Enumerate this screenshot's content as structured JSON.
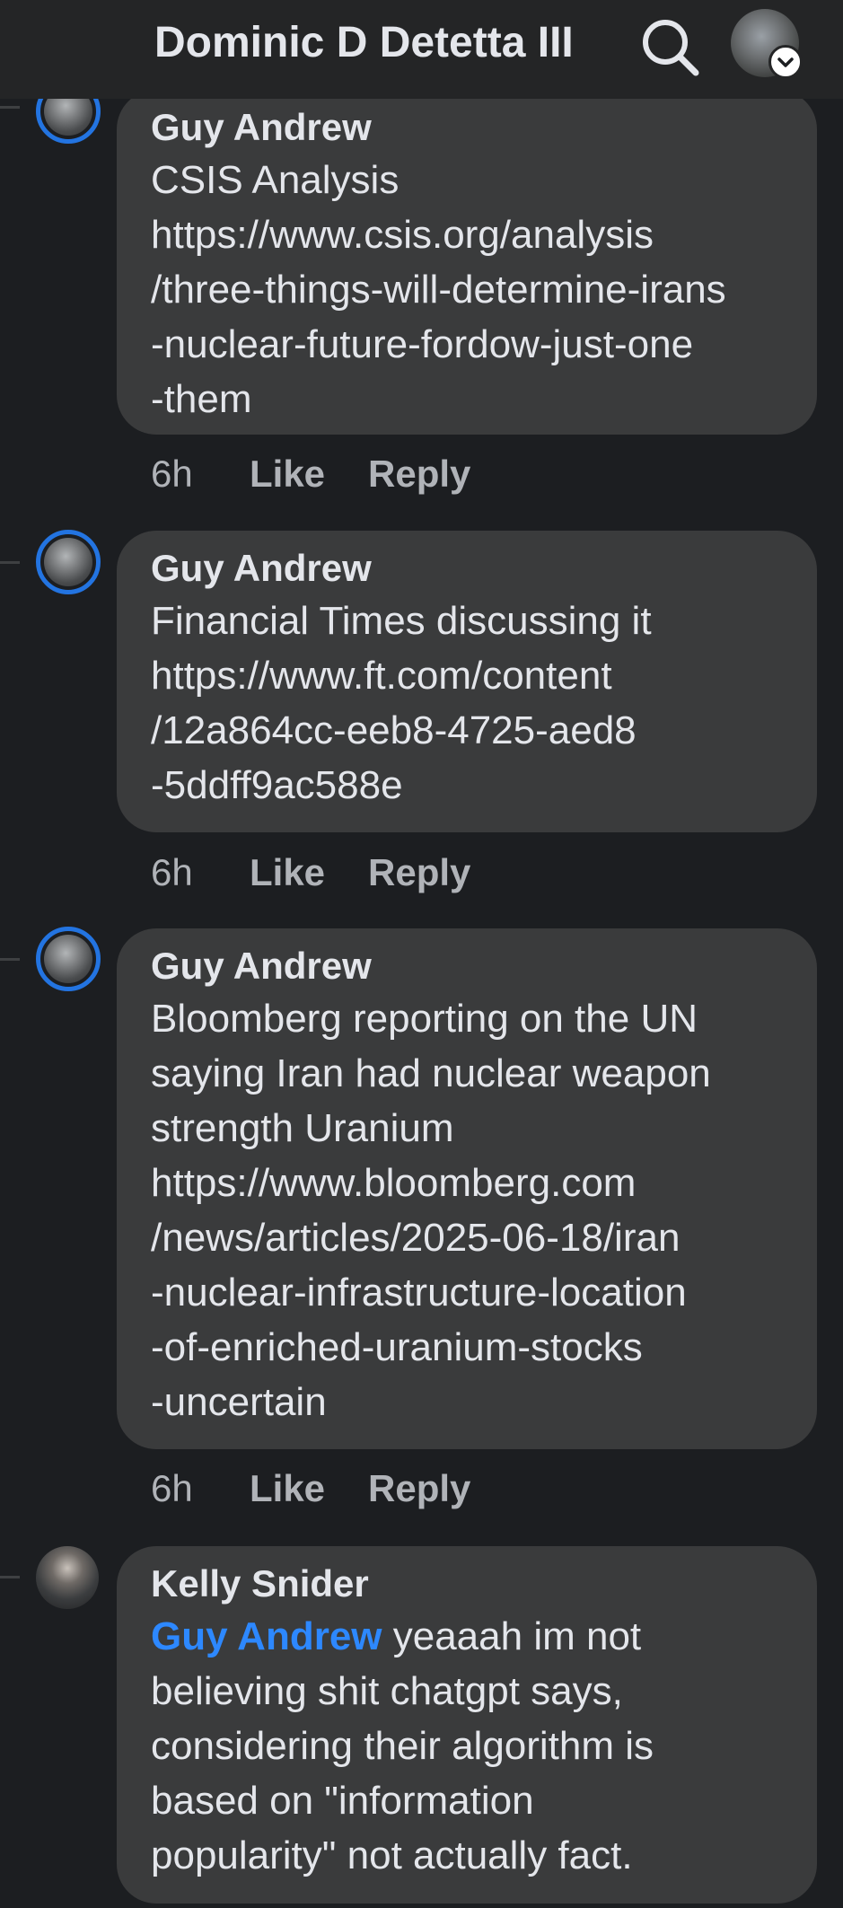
{
  "header": {
    "title": "Dominic D Detetta III",
    "search_icon": "search-icon",
    "account_icon": "chevron-down-icon"
  },
  "comments": [
    {
      "author": "Guy Andrew",
      "text": "CSIS Analysis\nhttps://www.csis.org/analysis\n/three-things-will-determine-irans\n-nuclear-future-fordow-just-one\n-them",
      "time": "6h",
      "like_label": "Like",
      "reply_label": "Reply"
    },
    {
      "author": "Guy Andrew",
      "text": "Financial Times discussing it\nhttps://www.ft.com/content\n/12a864cc-eeb8-4725-aed8\n-5ddff9ac588e",
      "time": "6h",
      "like_label": "Like",
      "reply_label": "Reply"
    },
    {
      "author": "Guy Andrew",
      "text": "Bloomberg reporting on the UN\nsaying Iran had nuclear weapon\nstrength Uranium\nhttps://www.bloomberg.com\n/news/articles/2025-06-18/iran\n-nuclear-infrastructure-location\n-of-enriched-uranium-stocks\n-uncertain",
      "time": "6h",
      "like_label": "Like",
      "reply_label": "Reply"
    },
    {
      "author": "Kelly Snider",
      "mention": "Guy Andrew",
      "text": " yeaaah im not\nbelieving shit chatgpt says,\nconsidering their algorithm is\nbased on \"information\npopularity\" not actually fact."
    }
  ],
  "colors": {
    "background": "#1c1e21",
    "bubble": "#3a3b3c",
    "accent": "#2374e1",
    "mention": "#2d88ff",
    "muted": "#b0b3b8"
  }
}
